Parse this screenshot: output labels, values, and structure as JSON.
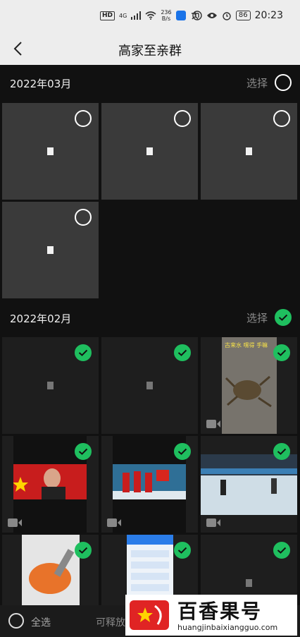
{
  "status_bar": {
    "hd": "HD",
    "network": "4G",
    "speed_value": "236",
    "speed_unit": "B/s",
    "battery": "86",
    "time": "20:23"
  },
  "header": {
    "title": "高家至亲群",
    "back_icon": "chevron-left-icon"
  },
  "sections": [
    {
      "date": "2022年03月",
      "select_label": "选择",
      "all_selected": false
    },
    {
      "date": "2022年02月",
      "select_label": "选择",
      "all_selected": true
    }
  ],
  "photo_caption": "古来水 嘿得 手嘛",
  "bottom_bar": {
    "select_all_label": "全选",
    "release_label": "可释放"
  },
  "watermark": {
    "brand": "百香果号",
    "url": "huangjinbaixiangguo.com"
  },
  "colors": {
    "accent_green": "#1fbf5f",
    "background": "#111111",
    "tile": "#3a3a3a"
  }
}
